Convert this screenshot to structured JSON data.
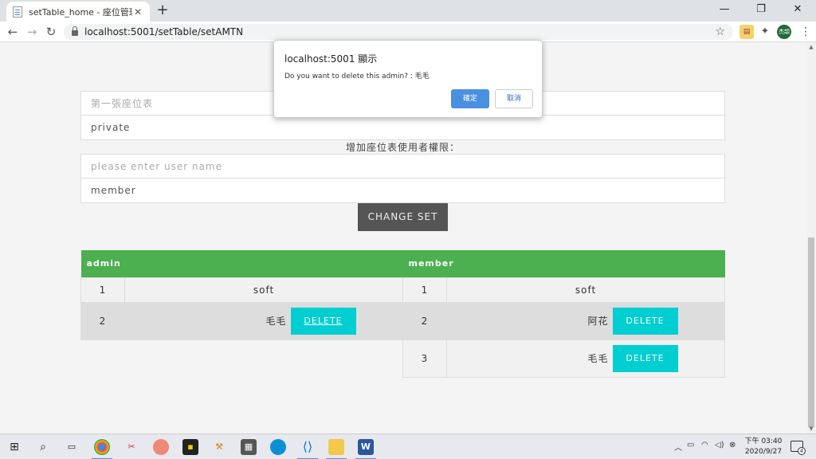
{
  "browser": {
    "tab_title": "setTable_home - 座位管理系統",
    "tab_close": "✕",
    "new_tab": "+",
    "url": "localhost:5001/setTable/setAMTN",
    "window_controls": [
      "—",
      "❐",
      "✕"
    ]
  },
  "form": {
    "table_name_placeholder": "第一張座位表",
    "privacy_value": "private",
    "section_label": "增加座位表使用者權限：",
    "username_placeholder": "please enter user name",
    "role_value": "member",
    "change_button": "CHANGE SET"
  },
  "admin_table": {
    "header": "admin",
    "rows": [
      {
        "index": "1",
        "name": "soft",
        "action": ""
      },
      {
        "index": "2",
        "name": "毛毛",
        "action": "DELETE"
      }
    ]
  },
  "member_table": {
    "header": "member",
    "rows": [
      {
        "index": "1",
        "name": "soft",
        "action": ""
      },
      {
        "index": "2",
        "name": "阿花",
        "action": "DELETE"
      },
      {
        "index": "3",
        "name": "毛毛",
        "action": "DELETE"
      }
    ]
  },
  "dialog": {
    "title": "localhost:5001 顯示",
    "message": "Do you want to delete this admin? : 毛毛",
    "ok": "確定",
    "cancel": "取消"
  },
  "taskbar": {
    "time": "下午 03:40",
    "date": "2020/9/27",
    "notification_count": "4"
  },
  "profile_initials": "杰頡",
  "colors": {
    "header_green": "#4caf50",
    "delete_cyan": "#00ced1",
    "change_button_bg": "#555555",
    "dialog_ok_blue": "#4a90e2"
  }
}
